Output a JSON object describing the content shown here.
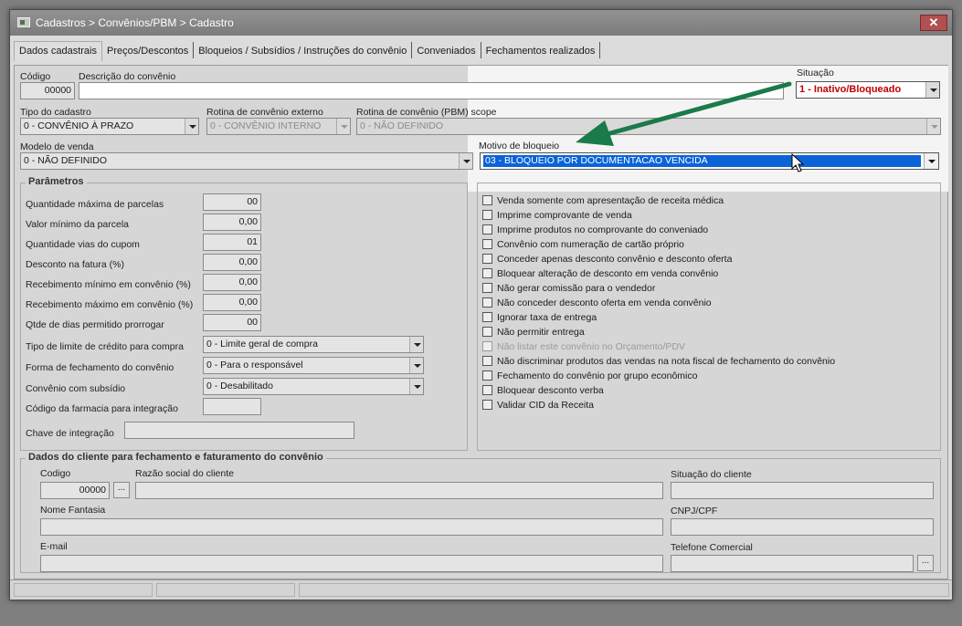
{
  "window": {
    "title": "Cadastros > Convênios/PBM > Cadastro",
    "close": "✕"
  },
  "tabs": [
    "Dados cadastrais",
    "Preços/Descontos",
    "Bloqueios / Subsídios / Instruções do convênio",
    "Conveniados",
    "Fechamentos realizados"
  ],
  "header": {
    "codigo_label": "Código",
    "codigo_value": "00000",
    "descricao_label": "Descrição do convênio",
    "descricao_value": "",
    "situacao_label": "Situação",
    "situacao_value": "1 - Inativo/Bloqueado",
    "tipo_label": "Tipo do cadastro",
    "tipo_value": "0 - CONVÊNIO À PRAZO",
    "rotina_ext_label": "Rotina de convênio externo",
    "rotina_ext_value": "0 - CONVÊNIO INTERNO",
    "rotina_pbm_label": "Rotina de convênio (PBM) scope",
    "rotina_pbm_value": "0 - NÃO DEFINIDO",
    "modelo_label": "Modelo de venda",
    "modelo_value": "0 - NÃO DEFINIDO",
    "motivo_label": "Motivo de bloqueio",
    "motivo_value": "03 - BLOQUEIO POR DOCUMENTACAO VENCIDA"
  },
  "parametros": {
    "title": "Parâmetros",
    "fields": [
      {
        "label": "Quantidade máxima de parcelas",
        "value": "00"
      },
      {
        "label": "Valor mínimo da parcela",
        "value": "0,00"
      },
      {
        "label": "Quantidade vias do cupom",
        "value": "01"
      },
      {
        "label": "Desconto na fatura (%)",
        "value": "0,00"
      },
      {
        "label": "Recebimento mínimo em convênio (%)",
        "value": "0,00"
      },
      {
        "label": "Recebimento máximo em convênio (%)",
        "value": "0,00"
      },
      {
        "label": "Qtde de dias permitido prorrogar",
        "value": "00"
      }
    ],
    "limite_label": "Tipo de limite de crédito para compra",
    "limite_value": "0 - Limite geral de compra",
    "fechamento_label": "Forma de fechamento do convênio",
    "fechamento_value": "0 - Para o responsável",
    "subsidio_label": "Convênio com subsídio",
    "subsidio_value": "0 - Desabilitado",
    "farmacia_label": "Código da farmacia para integração",
    "farmacia_value": "",
    "chave_label": "Chave de integração",
    "chave_value": ""
  },
  "checkboxes": [
    "Venda somente com apresentação de receita médica",
    "Imprime comprovante de venda",
    "Imprime produtos no comprovante do conveniado",
    "Convênio com numeração de cartão próprio",
    "Conceder apenas desconto convênio e desconto oferta",
    "Bloquear alteração de desconto em venda convênio",
    "Não gerar comissão para o vendedor",
    "Não conceder desconto oferta em venda convênio",
    "Ignorar taxa de entrega",
    "Não permitir entrega",
    "Não listar este convênio no Orçamento/PDV",
    "Não discriminar produtos das vendas na nota fiscal de fechamento do convênio",
    "Fechamento do convênio por grupo econômico",
    "Bloquear desconto verba",
    "Validar CID da Receita"
  ],
  "cliente": {
    "title": "Dados do cliente para fechamento e faturamento do convênio",
    "codigo_label": "Codigo",
    "codigo_value": "00000",
    "lookup_btn": "...",
    "razao_label": "Razão social do cliente",
    "situacao_label": "Situação do cliente",
    "fantasia_label": "Nome Fantasia",
    "cnpj_label": "CNPJ/CPF",
    "email_label": "E-mail",
    "telefone_label": "Telefone Comercial",
    "telefone_btn": "..."
  },
  "colors": {
    "situacao_text": "#c00000",
    "selection_bg": "#0a64d8",
    "arrow": "#1a7a4a"
  }
}
